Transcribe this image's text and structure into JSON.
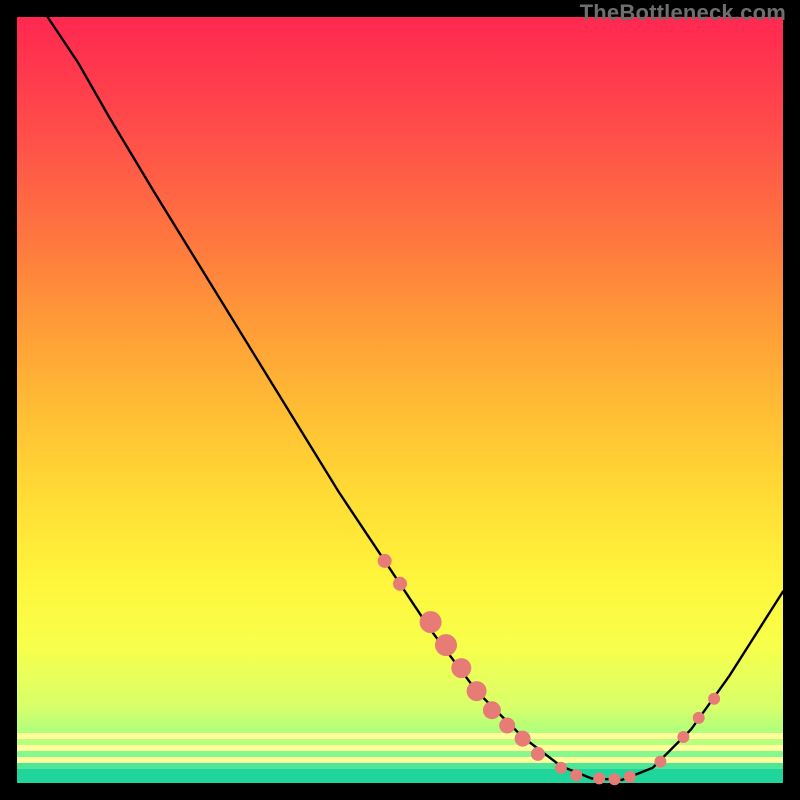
{
  "watermark": "TheBottleneck.com",
  "colors": {
    "curve": "#000000",
    "dot_fill": "#e77b76",
    "dot_stroke": "#c85a55"
  },
  "chart_data": {
    "type": "line",
    "title": "",
    "xlabel": "",
    "ylabel": "",
    "xlim": [
      0,
      100
    ],
    "ylim": [
      0,
      100
    ],
    "curve": [
      {
        "x": 4,
        "y": 100
      },
      {
        "x": 8,
        "y": 94
      },
      {
        "x": 12,
        "y": 87
      },
      {
        "x": 18,
        "y": 77
      },
      {
        "x": 26,
        "y": 64
      },
      {
        "x": 34,
        "y": 51
      },
      {
        "x": 42,
        "y": 38
      },
      {
        "x": 48,
        "y": 29
      },
      {
        "x": 54,
        "y": 20
      },
      {
        "x": 60,
        "y": 12
      },
      {
        "x": 66,
        "y": 6
      },
      {
        "x": 71,
        "y": 2.2
      },
      {
        "x": 75,
        "y": 0.6
      },
      {
        "x": 79,
        "y": 0.4
      },
      {
        "x": 83,
        "y": 2
      },
      {
        "x": 88,
        "y": 7
      },
      {
        "x": 93,
        "y": 14
      },
      {
        "x": 100,
        "y": 25
      }
    ],
    "scatter": [
      {
        "x": 48,
        "y": 29,
        "r": 7
      },
      {
        "x": 50,
        "y": 26,
        "r": 7
      },
      {
        "x": 54,
        "y": 21,
        "r": 11
      },
      {
        "x": 56,
        "y": 18,
        "r": 11
      },
      {
        "x": 58,
        "y": 15,
        "r": 10
      },
      {
        "x": 60,
        "y": 12,
        "r": 10
      },
      {
        "x": 62,
        "y": 9.5,
        "r": 9
      },
      {
        "x": 64,
        "y": 7.5,
        "r": 8
      },
      {
        "x": 66,
        "y": 5.8,
        "r": 8
      },
      {
        "x": 68,
        "y": 3.8,
        "r": 7
      },
      {
        "x": 71,
        "y": 2.0,
        "r": 6
      },
      {
        "x": 73,
        "y": 1.0,
        "r": 6
      },
      {
        "x": 76,
        "y": 0.6,
        "r": 6
      },
      {
        "x": 78,
        "y": 0.5,
        "r": 6
      },
      {
        "x": 80,
        "y": 0.8,
        "r": 6
      },
      {
        "x": 84,
        "y": 2.8,
        "r": 6
      },
      {
        "x": 87,
        "y": 6.0,
        "r": 6
      },
      {
        "x": 89,
        "y": 8.5,
        "r": 6
      },
      {
        "x": 91,
        "y": 11,
        "r": 6
      }
    ]
  }
}
